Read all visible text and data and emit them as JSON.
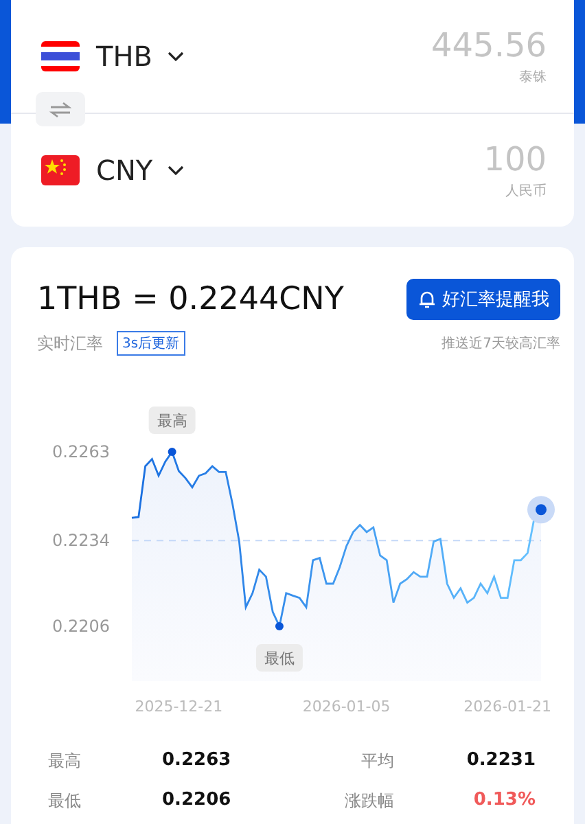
{
  "converter": {
    "currencies": [
      {
        "code": "THB",
        "amount": "445.56",
        "name": "泰铢"
      },
      {
        "code": "CNY",
        "amount": "100",
        "name": "人民币"
      }
    ]
  },
  "rate": {
    "headline": "1THB = 0.2244CNY",
    "label": "实时汇率",
    "countdown": "3s后更新",
    "alert_button": "好汇率提醒我",
    "alert_hint": "推送近7天较高汇率",
    "chart_data": {
      "type": "area",
      "ylim": [
        0.2206,
        0.2263
      ],
      "yticks": [
        0.2206,
        0.2234,
        0.2263
      ],
      "categories": [
        null,
        null,
        null,
        null,
        null,
        null,
        null,
        "2025-12-21",
        null,
        null,
        null,
        null,
        null,
        null,
        null,
        null,
        null,
        null,
        null,
        null,
        null,
        null,
        null,
        null,
        null,
        null,
        null,
        null,
        null,
        null,
        null,
        null,
        "2026-01-05",
        null,
        null,
        null,
        null,
        null,
        null,
        null,
        null,
        null,
        null,
        null,
        null,
        null,
        null,
        null,
        null,
        null,
        null,
        null,
        null,
        null,
        null,
        null,
        "2026-01-21",
        null,
        null,
        null,
        null,
        null
      ],
      "series": [
        {
          "color": "#1a6fe0",
          "values": [
            0.22414,
            0.22417,
            0.22583,
            0.22606,
            0.22552,
            0.22598,
            0.2263,
            0.22567,
            0.22544,
            0.22514,
            0.22552,
            0.2256,
            0.22583,
            0.22564,
            0.22564,
            0.2246,
            0.22337,
            0.22122,
            0.22168,
            0.22245,
            0.22222,
            0.22107,
            0.2206,
            0.22168,
            0.2216,
            0.22153,
            0.22122,
            0.22276,
            0.22283,
            0.22199,
            0.22199,
            0.22253,
            0.22322,
            0.22368,
            0.22391,
            0.22368,
            0.22383,
            0.22291,
            0.22276,
            0.22137,
            0.22199,
            0.22214,
            0.22237,
            0.22222,
            0.22222,
            0.22337,
            0.22345,
            0.22199,
            0.22153,
            0.22184,
            0.22137,
            0.22153,
            0.22199,
            0.22168,
            0.22222,
            0.22153,
            0.22153,
            0.22276,
            0.22276,
            0.22299,
            0.22414,
            0.22441
          ]
        }
      ],
      "ref_lines": [
        {
          "axis": "y",
          "value": 0.2234
        }
      ],
      "annotations": [
        {
          "text": "最高",
          "y": 0.2263
        },
        {
          "text": "最低",
          "y": 0.2206
        }
      ]
    },
    "stats": [
      {
        "label": "最高",
        "value": "0.2263",
        "kind": "plain"
      },
      {
        "label": "平均",
        "value": "0.2231",
        "kind": "plain"
      },
      {
        "label": "最低",
        "value": "0.2206",
        "kind": "plain"
      },
      {
        "label": "涨跌幅",
        "value": "0.13%",
        "kind": "change"
      }
    ]
  }
}
